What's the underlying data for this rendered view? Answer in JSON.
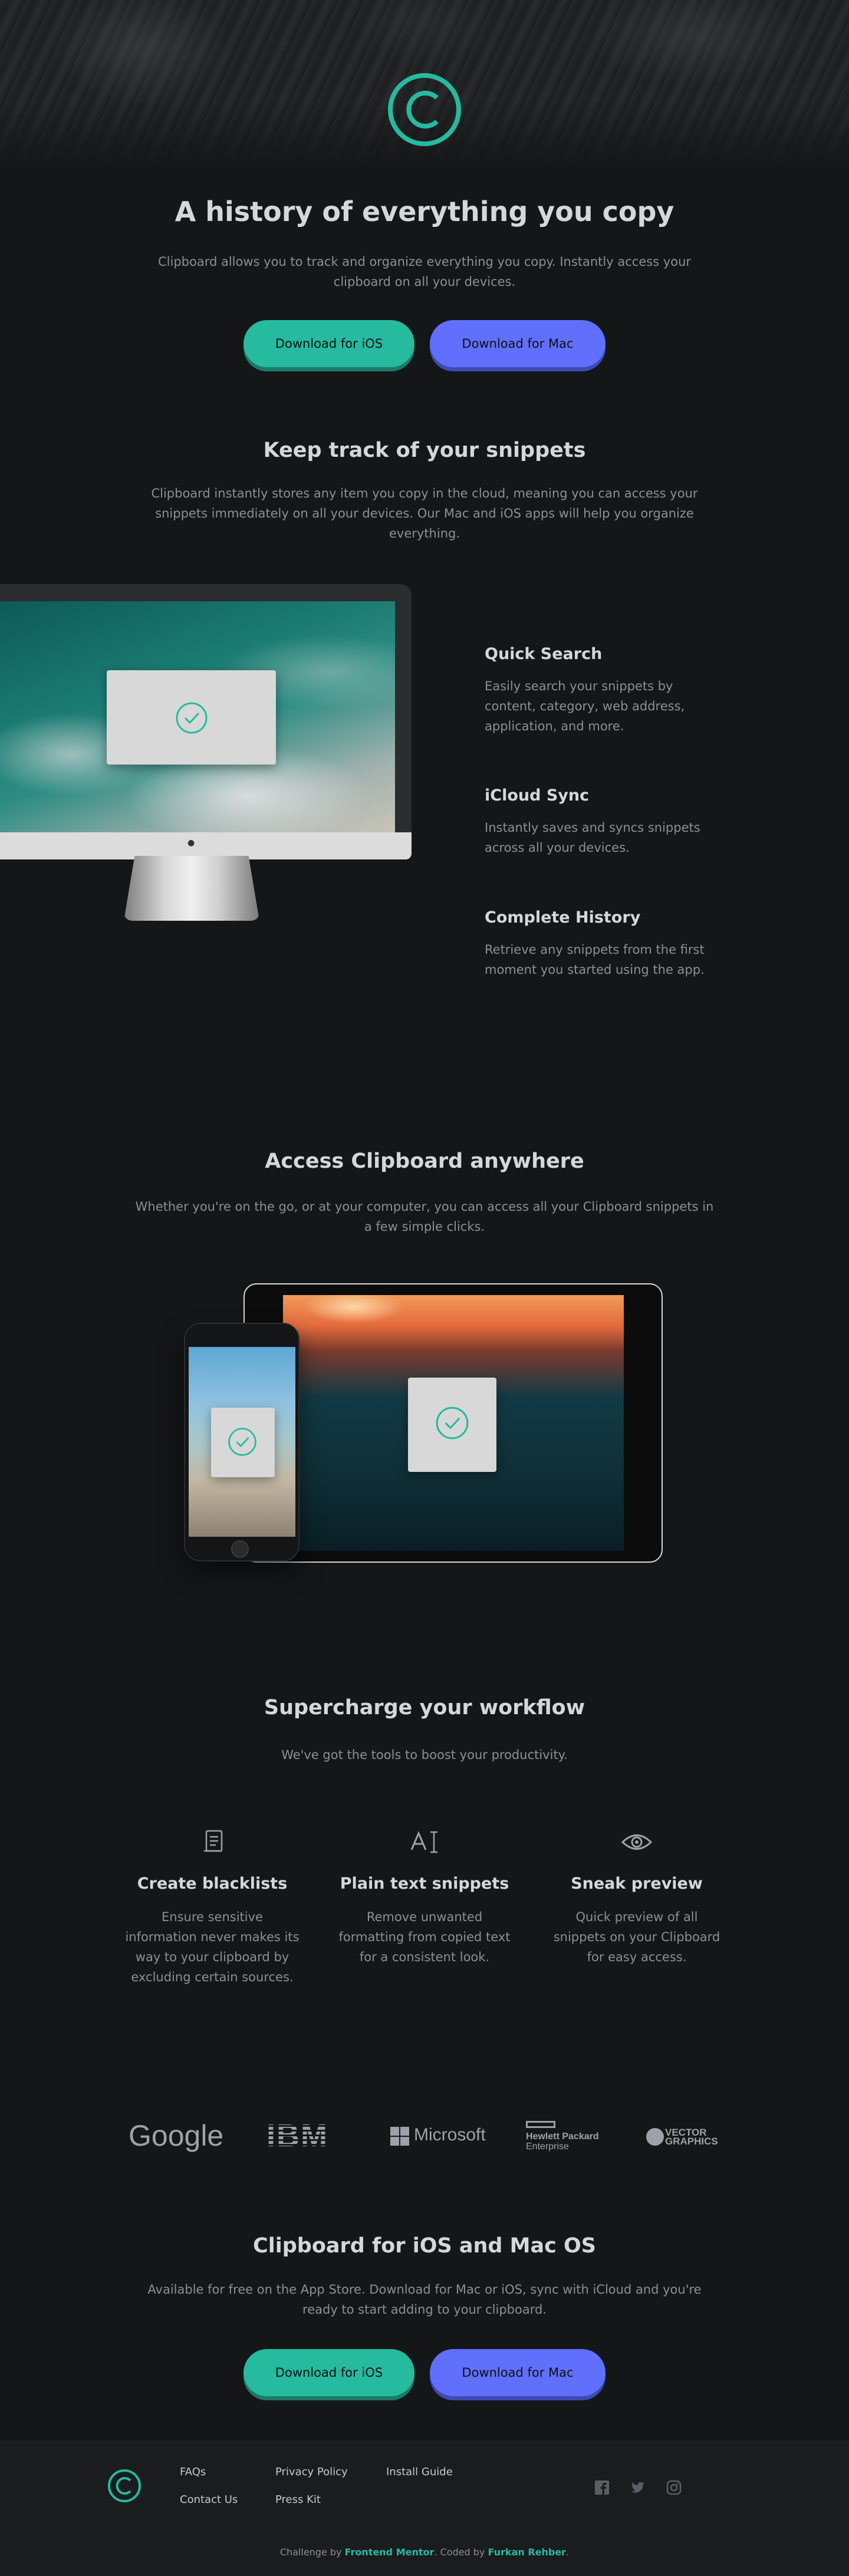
{
  "hero": {
    "title": "A history of everything you copy",
    "subtitle_line1": "Clipboard allows you to track and organize everything you copy. Instantly access your",
    "subtitle_line2": "clipboard on all your devices.",
    "btn_ios": "Download for iOS",
    "btn_mac": "Download for Mac"
  },
  "snippets": {
    "title": "Keep track of your snippets",
    "text_line1": "Clipboard instantly stores any item you copy in the cloud, meaning you can access your",
    "text_line2": "snippets immediately on all your devices. Our Mac and iOS apps will help you organize",
    "text_line3": "everything.",
    "features": [
      {
        "title": "Quick Search",
        "line1": "Easily search your snippets by",
        "line2": "content, category, web address,",
        "line3": "application, and more."
      },
      {
        "title": "iCloud Sync",
        "line1": "Instantly saves and syncs snippets",
        "line2": "across all your devices."
      },
      {
        "title": "Complete History",
        "line1": "Retrieve any snippets from the first",
        "line2": "moment you started using the app."
      }
    ]
  },
  "access": {
    "title": "Access Clipboard anywhere",
    "text_line1": "Whether you're on the go, or at your computer, you can access all your Clipboard snippets in",
    "text_line2": "a few simple clicks."
  },
  "workflow": {
    "title": "Supercharge your workflow",
    "subtitle": "We've got the tools to boost your productivity.",
    "tools": [
      {
        "icon": "blacklist-icon",
        "title": "Create blacklists",
        "line1": "Ensure sensitive",
        "line2": "information never makes its",
        "line3": "way to your clipboard by",
        "line4": "excluding certain sources."
      },
      {
        "icon": "text-icon",
        "title": "Plain text snippets",
        "line1": "Remove unwanted",
        "line2": "formatting from copied text",
        "line3": "for a consistent look."
      },
      {
        "icon": "eye-icon",
        "title": "Sneak preview",
        "line1": "Quick preview of all",
        "line2": "snippets on your Clipboard",
        "line3": "for easy access."
      }
    ]
  },
  "partners": {
    "google": "Google",
    "ibm": "IBM",
    "microsoft": "Microsoft",
    "hp_line1": "Hewlett Packard",
    "hp_line2": "Enterprise",
    "vector_line1": "VECTOR",
    "vector_line2": "GRAPHICS"
  },
  "cta": {
    "title": "Clipboard for iOS and Mac OS",
    "text_line1": "Available for free on the App Store. Download for Mac or iOS, sync with iCloud and you're",
    "text_line2": "ready to start adding to your clipboard.",
    "btn_ios": "Download for iOS",
    "btn_mac": "Download for Mac"
  },
  "footer": {
    "links": {
      "faqs": "FAQs",
      "contact": "Contact Us",
      "privacy": "Privacy Policy",
      "press": "Press Kit",
      "install": "Install Guide"
    },
    "credit_prefix": "Challenge by",
    "credit_fm": "Frontend Mentor",
    "credit_mid": ". Coded by",
    "credit_author": "Furkan Rehber",
    "credit_end": "."
  },
  "colors": {
    "accent_green": "#26ba9f",
    "accent_blue": "#6070fd",
    "background": "#151617",
    "footer_bg": "#1b1c1e"
  }
}
